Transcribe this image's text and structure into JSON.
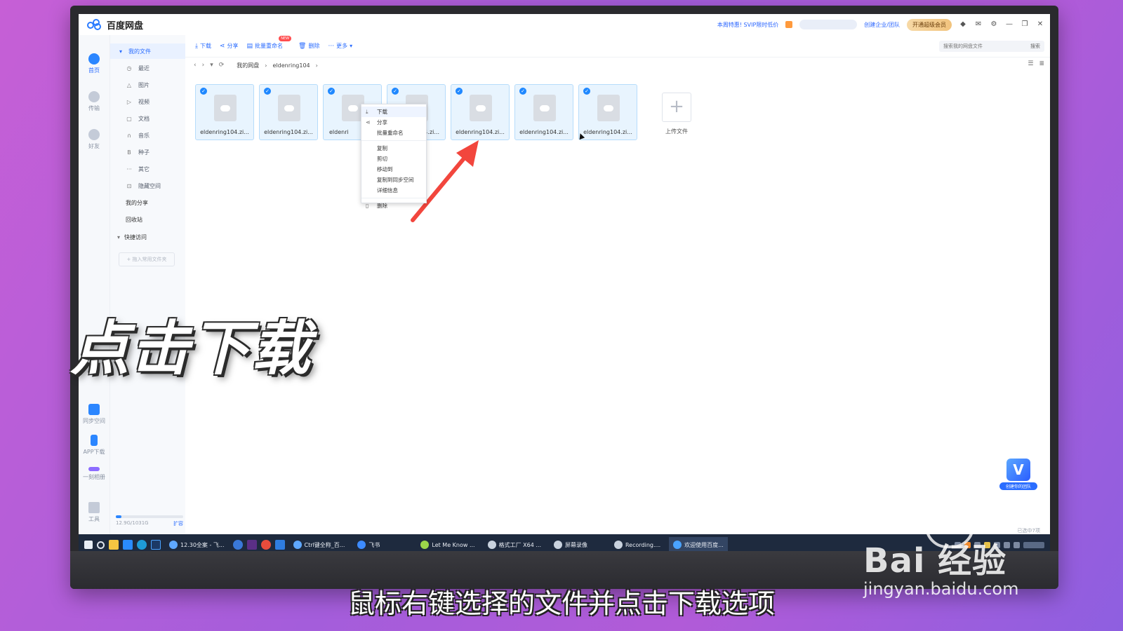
{
  "app": {
    "title": "百度网盘"
  },
  "titlebar": {
    "promo": "本周特惠! SVIP限时低价",
    "create_team": "创建企业/团队",
    "svip_button": "开通超级会员",
    "window_controls": [
      "minimize-icon",
      "restore-icon",
      "close-icon"
    ]
  },
  "rail": {
    "items": [
      {
        "label": "首页",
        "icon": "cloud-home-icon"
      },
      {
        "label": "传输",
        "icon": "transfer-icon"
      },
      {
        "label": "好友",
        "icon": "friends-icon"
      },
      {
        "label": "同步空间",
        "icon": "sync-icon"
      },
      {
        "label": "APP下载",
        "icon": "phone-icon"
      },
      {
        "label": "一刻相册",
        "icon": "album-icon"
      },
      {
        "label": "工具",
        "icon": "tools-icon"
      }
    ]
  },
  "sidebar": {
    "my_files": "我的文件",
    "items": [
      {
        "label": "最近",
        "icon": "clock-icon"
      },
      {
        "label": "图片",
        "icon": "image-icon"
      },
      {
        "label": "视频",
        "icon": "play-icon"
      },
      {
        "label": "文档",
        "icon": "document-icon"
      },
      {
        "label": "音乐",
        "icon": "headphones-icon"
      },
      {
        "label": "种子",
        "icon": "bt-icon"
      },
      {
        "label": "其它",
        "icon": "more-icon"
      },
      {
        "label": "隐藏空间",
        "icon": "lock-icon"
      }
    ],
    "my_share": "我的分享",
    "recycle": "回收站",
    "quick_access": "快捷访问",
    "quick_add": "+ 拖入常用文件夹",
    "storage": {
      "used_text": "12.9G/1031G",
      "expand": "扩容",
      "used_fraction": 0.0125
    }
  },
  "toolbar": {
    "download": "下载",
    "share": "分享",
    "batch_rename": "批量重命名",
    "new_badge": "NEW",
    "delete": "删除",
    "more": "更多",
    "search_placeholder": "搜索我的网盘文件",
    "search_button": "搜索"
  },
  "path": {
    "root": "我的网盘",
    "folder": "eldenring104"
  },
  "files": [
    {
      "name": "eldenring104.zi..."
    },
    {
      "name": "eldenring104.zi..."
    },
    {
      "name": "eldenri"
    },
    {
      "name": "104.zi..."
    },
    {
      "name": "eldenring104.zi..."
    },
    {
      "name": "eldenring104.zi..."
    },
    {
      "name": "eldenring104.zi..."
    }
  ],
  "upload": {
    "label": "上传文件"
  },
  "context_menu": {
    "items": [
      "下载",
      "分享",
      "批量重命名",
      "复制",
      "剪切",
      "移动到",
      "复制到同步空间",
      "详细信息",
      "删除"
    ]
  },
  "widget": {
    "letter": "V",
    "label": "创建你的团队"
  },
  "selected_count": "已选中7项",
  "taskbar": {
    "tasks": [
      "12.30全案 - 飞...",
      "Ctrl键全称_百...",
      "飞书",
      "Let Me Know ...",
      "格式工厂 X64 ...",
      "屏幕录像",
      "Recording....",
      "欢迎使用百度..."
    ]
  },
  "overlay": {
    "title": "点击下载",
    "subtitle": "鼠标右键选择的文件并点击下载选项"
  },
  "watermark": {
    "logo": "Bai 经验",
    "url": "jingyan.baidu.com"
  }
}
